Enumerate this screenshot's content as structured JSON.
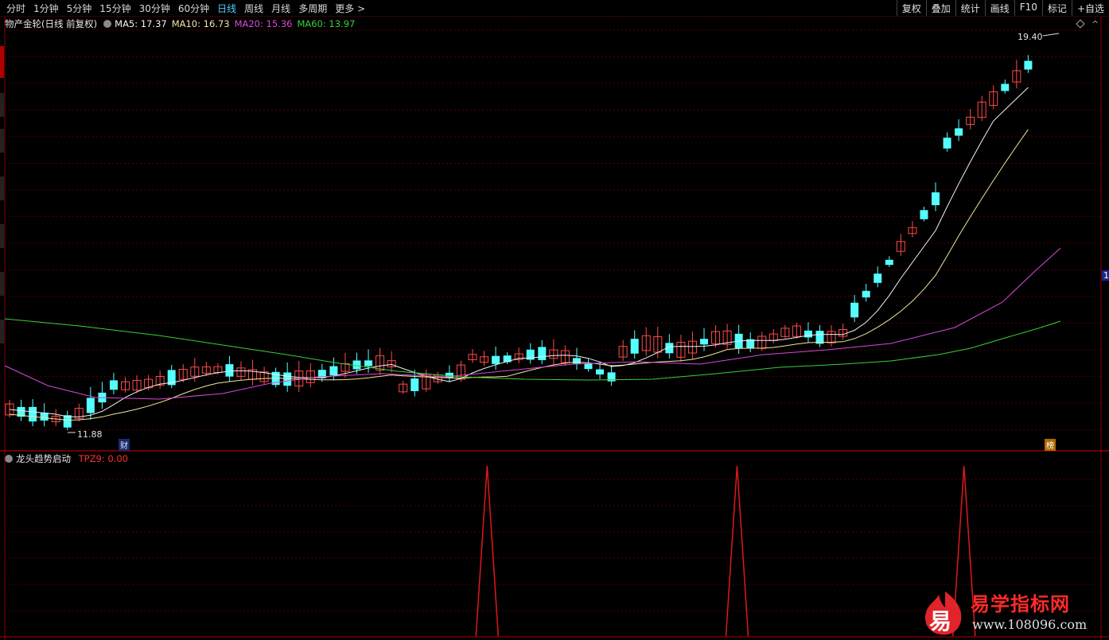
{
  "toolbar": {
    "periods": [
      "分时",
      "1分钟",
      "5分钟",
      "15分钟",
      "30分钟",
      "60分钟",
      "日线",
      "周线",
      "月线",
      "多周期",
      "更多 >"
    ],
    "active_period": "日线",
    "right_buttons": [
      "复权",
      "叠加",
      "统计",
      "画线",
      "F10",
      "标记",
      "+自选"
    ]
  },
  "main_chart": {
    "stock_title": "物产金轮(日线 前复权)",
    "ma_labels": [
      {
        "text": "MA5: 17.37",
        "color": "#f2f2f2"
      },
      {
        "text": "MA10: 16.73",
        "color": "#f4e49c"
      },
      {
        "text": "MA20: 15.36",
        "color": "#d948d9"
      },
      {
        "text": "MA60: 13.97",
        "color": "#38d038"
      }
    ],
    "high_label": "19.40",
    "low_label": "11.88",
    "cai_badge": "财",
    "bang_badge": "榜",
    "right_marker": "1"
  },
  "indicator": {
    "name": "龙头趋势启动",
    "value_label": "TPZ9: 0.00",
    "spike_positions": [
      0.44,
      0.668,
      0.875
    ]
  },
  "watermark": {
    "logo_char": "易",
    "title": "易学指标网",
    "url": "www.108096.com"
  },
  "colors": {
    "up": "#ff4a4a",
    "down": "#54ffff",
    "grid": "#6e0000",
    "indicator_line": "#e01818"
  }
}
